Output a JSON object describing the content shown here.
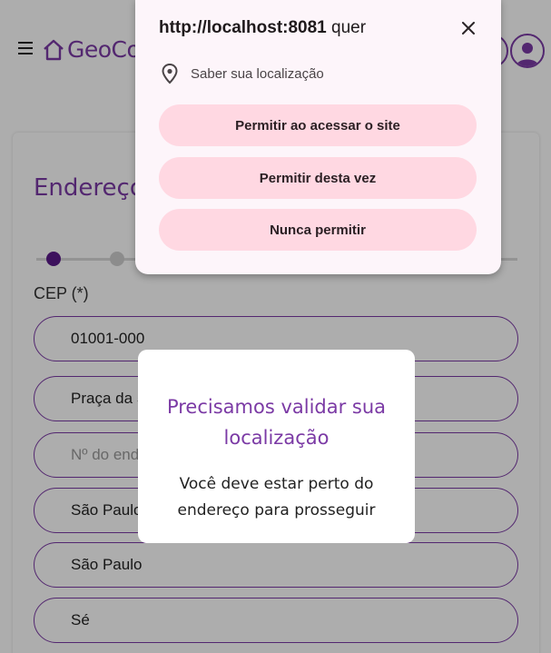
{
  "header": {
    "logo_text": "GeoCo"
  },
  "form": {
    "title": "Endereço",
    "cep_label": "CEP (*)",
    "fields": [
      {
        "value": "01001-000",
        "placeholder": ""
      },
      {
        "value": "Praça da Sé",
        "placeholder": ""
      },
      {
        "value": "",
        "placeholder": "Nº do endereço"
      },
      {
        "value": "São Paulo",
        "placeholder": ""
      },
      {
        "value": "São Paulo",
        "placeholder": ""
      },
      {
        "value": "Sé",
        "placeholder": ""
      }
    ]
  },
  "modal": {
    "title": "Precisamos validar sua localização",
    "text": "Você deve estar perto do endereço para prosseguir"
  },
  "permission": {
    "origin": "http://localhost:8081",
    "verb": " quer",
    "request": "Saber sua localização",
    "buttons": {
      "allow_always": "Permitir ao acessar o site",
      "allow_once": "Permitir desta vez",
      "never": "Nunca permitir"
    }
  },
  "colors": {
    "brand": "#7b3aa5",
    "button_bg": "#ffd8e2",
    "popup_bg": "#fdf5fa"
  }
}
